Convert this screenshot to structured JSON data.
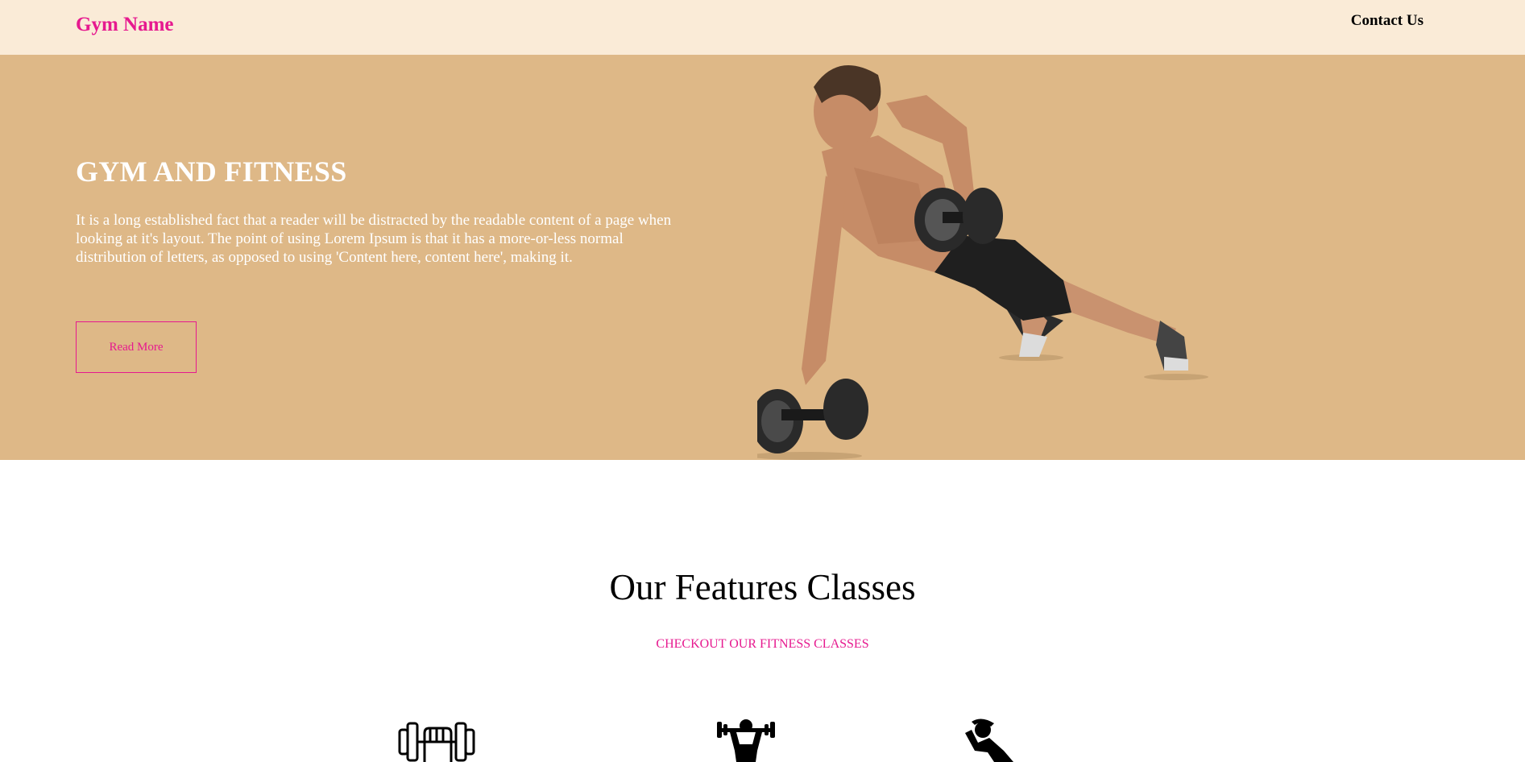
{
  "nav": {
    "brand": "Gym Name",
    "contact": "Contact Us"
  },
  "hero": {
    "title": "GYM AND FITNESS",
    "text": "It is a long established fact that a reader will be distracted by the readable content of a page when looking at it's layout. The point of using Lorem Ipsum is that it has a more-or-less normal distribution of letters, as opposed to using 'Content here, content here', making it.",
    "button_label": "Read More"
  },
  "features": {
    "title": "Our Features Classes",
    "subtitle": "CHECKOUT OUR FITNESS CLASSES",
    "icons": [
      "dumbbell-grip-icon",
      "weightlifter-icon",
      "situp-icon"
    ]
  },
  "colors": {
    "accent": "#e6198f",
    "nav_bg": "#faebd7",
    "hero_bg": "#deb887"
  }
}
